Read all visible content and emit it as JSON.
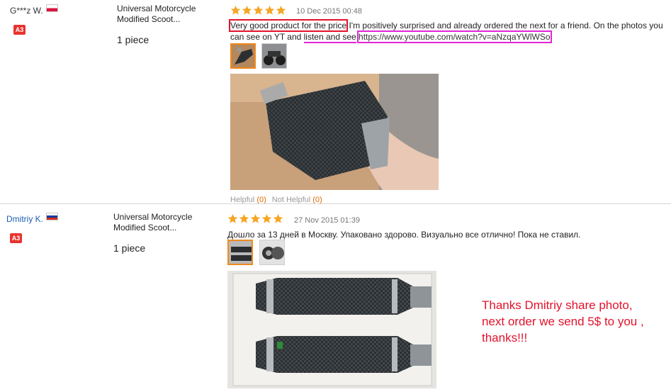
{
  "reviews": [
    {
      "user": "G***z W.",
      "country_flag": "poland-flag-icon",
      "badge": "A3",
      "product_line1": "Universal Motorcycle",
      "product_line2": "Modified Scoot...",
      "quantity": "1 piece",
      "rating": 5,
      "date": "10 Dec 2015 00:48",
      "text_part1": "Very good product for the price",
      "text_part2": " I'm positively surprised and already ordered the next for a friend. On the photos you can see on YT and ",
      "text_part3": "listen and see",
      "text_part4": " ",
      "link": "https://www.youtube.com/watch?v=aNzqaYWlWSo",
      "helpful_label": "Helpful",
      "helpful_count": "(0)",
      "not_helpful_label": "Not Helpful",
      "not_helpful_count": "(0)"
    },
    {
      "user": "Dmitriy K.",
      "country_flag": "russia-flag-icon",
      "badge": "A3",
      "product_line1": "Universal Motorcycle",
      "product_line2": "Modified Scoot...",
      "quantity": "1 piece",
      "rating": 5,
      "date": "27 Nov 2015 01:39",
      "text": "Дошло за 13 дней в Москву. Упаковано здорово. Визуально все отлично! Пока не ставил."
    }
  ],
  "seller_note": {
    "line1": "Thanks Dmitriy share photo,",
    "line2": "next order we send 5$ to you ,",
    "line3": "thanks!!!",
    "color": "#e3122b"
  },
  "colors": {
    "star": "#f5a623",
    "thumb_active_border": "#f08a1c",
    "highlight_red": "#e3122b",
    "highlight_magenta": "#e026d6"
  }
}
